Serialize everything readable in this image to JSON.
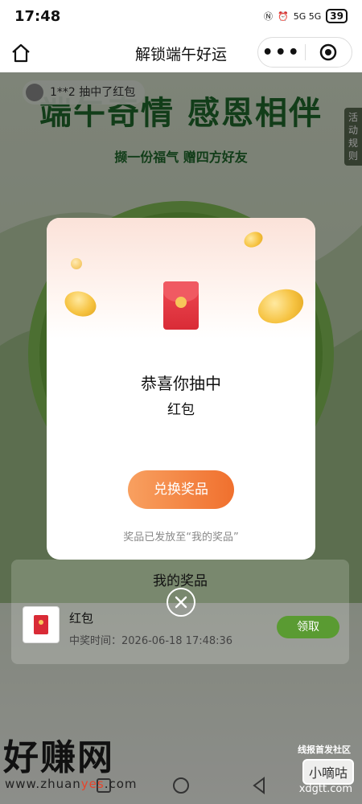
{
  "status_bar": {
    "time": "17:48",
    "network": "5G 5G",
    "battery": "39"
  },
  "nav": {
    "title": "解锁端午好运",
    "more_icon": "more-dots-icon",
    "target_icon": "target-icon",
    "home_icon": "home-icon"
  },
  "banner": {
    "title": "端午奇情 感恩相伴",
    "subtitle": "撷一份福气 赠四方好友",
    "winner_ticker": "1**2 抽中了红包",
    "rules_tab": "活动规则"
  },
  "my_prizes": {
    "title": "我的奖品",
    "items": [
      {
        "name": "红包",
        "time": "中奖时间：2026-06-18 17:48:36",
        "claim_label": "领取"
      }
    ]
  },
  "modal": {
    "congrats": "恭喜你抽中",
    "prize_name": "红包",
    "redeem_label": "兑换奖品",
    "note": "奖品已发放至“我的奖品”"
  },
  "watermarks": {
    "left_big": "好赚网",
    "left_url_pre": "www.zhuan",
    "left_url_hl": "yes",
    "left_url_post": ".com",
    "right_top": "线报首发社区",
    "right_box": "小嘀咕",
    "right_url": "xdgtt.com"
  },
  "colors": {
    "green_title": "#1f6a2b",
    "claim_green": "#5a9b32",
    "redeem_orange": "#f0702e",
    "red_packet": "#d92b36"
  }
}
